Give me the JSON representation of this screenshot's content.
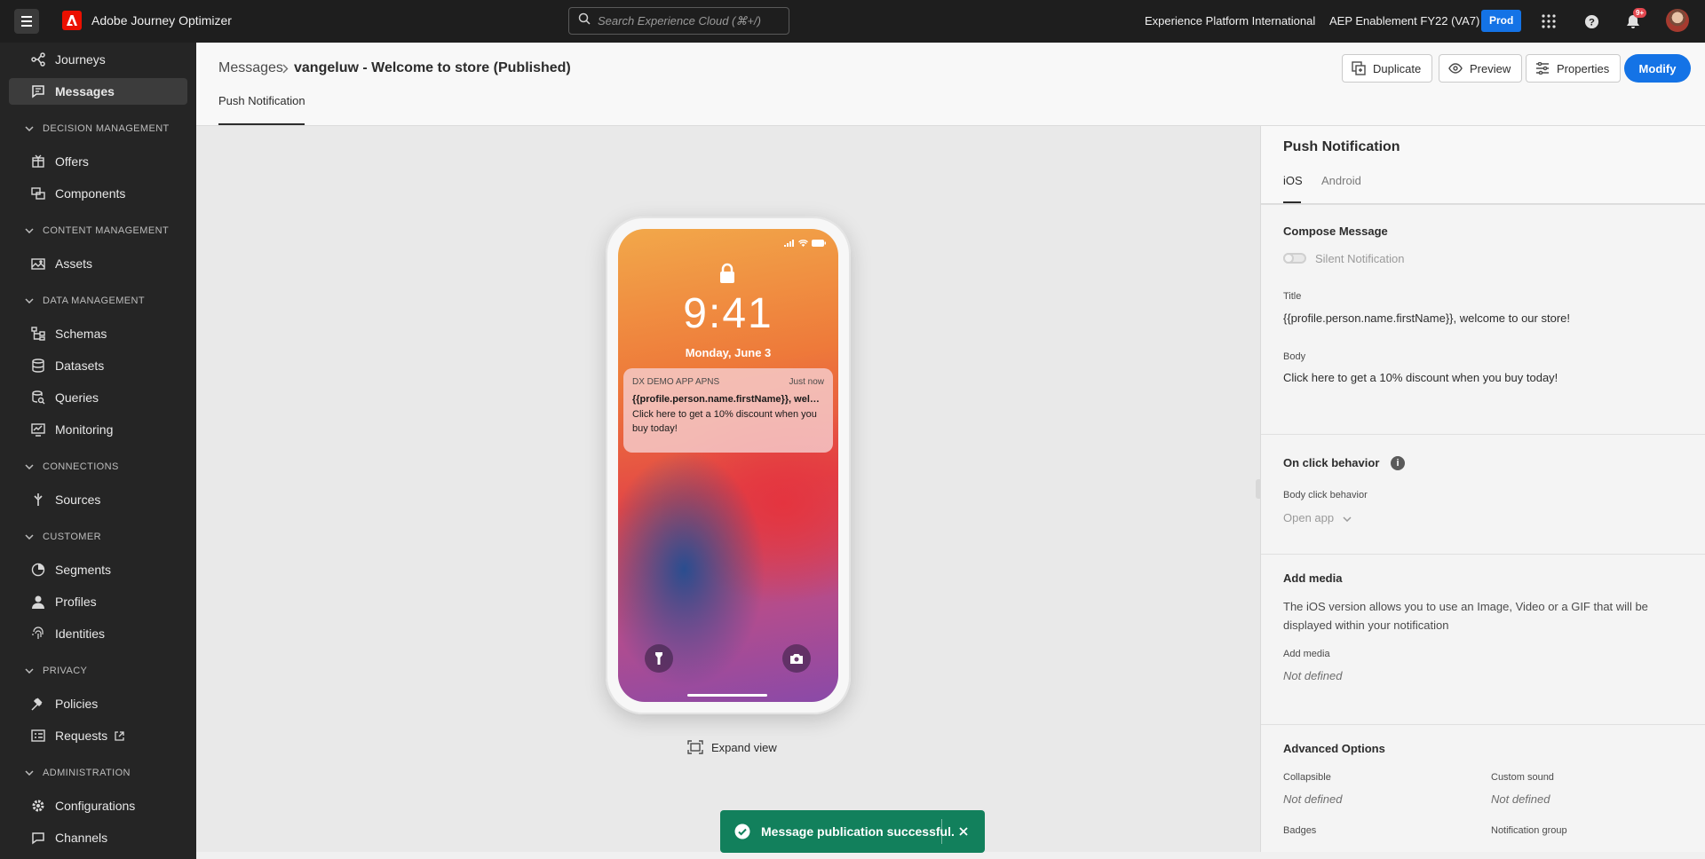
{
  "topbar": {
    "app_title": "Adobe Journey Optimizer",
    "search_placeholder": "Search Experience Cloud (⌘+/)",
    "org": "Experience Platform International",
    "sandbox": "AEP Enablement FY22 (VA7)",
    "env_badge": "Prod",
    "notification_count": "9+"
  },
  "sidebar": {
    "items": [
      {
        "label": "Journeys",
        "icon": "journeys-icon"
      },
      {
        "label": "Messages",
        "icon": "messages-icon",
        "active": true
      }
    ],
    "sections": [
      {
        "title": "DECISION MANAGEMENT",
        "items": [
          {
            "label": "Offers"
          },
          {
            "label": "Components"
          }
        ]
      },
      {
        "title": "CONTENT MANAGEMENT",
        "items": [
          {
            "label": "Assets"
          }
        ]
      },
      {
        "title": "DATA MANAGEMENT",
        "items": [
          {
            "label": "Schemas"
          },
          {
            "label": "Datasets"
          },
          {
            "label": "Queries"
          },
          {
            "label": "Monitoring"
          }
        ]
      },
      {
        "title": "CONNECTIONS",
        "items": [
          {
            "label": "Sources"
          }
        ]
      },
      {
        "title": "CUSTOMER",
        "items": [
          {
            "label": "Segments"
          },
          {
            "label": "Profiles"
          },
          {
            "label": "Identities"
          }
        ]
      },
      {
        "title": "PRIVACY",
        "items": [
          {
            "label": "Policies"
          },
          {
            "label": "Requests"
          }
        ]
      },
      {
        "title": "ADMINISTRATION",
        "items": [
          {
            "label": "Configurations"
          },
          {
            "label": "Channels"
          }
        ]
      }
    ]
  },
  "header": {
    "breadcrumb_root": "Messages",
    "breadcrumb_current": "vangeluw - Welcome to store (Published)",
    "buttons": {
      "duplicate": "Duplicate",
      "preview": "Preview",
      "properties": "Properties",
      "modify": "Modify"
    },
    "tab": "Push Notification"
  },
  "preview": {
    "time": "9:41",
    "date": "Monday, June 3",
    "notification": {
      "app": "DX DEMO APP APNS",
      "when": "Just now",
      "title": "{{profile.person.name.firstName}}, welcome to our store!",
      "body": "Click here to get a 10% discount when you buy today!"
    },
    "expand_label": "Expand view"
  },
  "toast": {
    "message": "Message publication successful."
  },
  "panel": {
    "title": "Push Notification",
    "tabs": [
      "iOS",
      "Android"
    ],
    "compose": {
      "heading": "Compose Message",
      "silent_label": "Silent Notification",
      "title_label": "Title",
      "title_value": "{{profile.person.name.firstName}}, welcome to our store!",
      "body_label": "Body",
      "body_value": "Click here to get a 10% discount when you buy today!"
    },
    "onclick": {
      "heading": "On click behavior",
      "label": "Body click behavior",
      "value": "Open app"
    },
    "media": {
      "heading": "Add media",
      "description": "The iOS version allows you to use an Image, Video or a GIF that will be displayed within your notification",
      "label": "Add media",
      "value": "Not defined"
    },
    "advanced": {
      "heading": "Advanced Options",
      "collapsible_label": "Collapsible",
      "collapsible_value": "Not defined",
      "sound_label": "Custom sound",
      "sound_value": "Not defined",
      "badges_label": "Badges",
      "group_label": "Notification group"
    }
  },
  "colors": {
    "accent": "#1473e6",
    "toast": "#12805c",
    "topbar": "#1e1e1e",
    "sidebar": "#252525"
  }
}
